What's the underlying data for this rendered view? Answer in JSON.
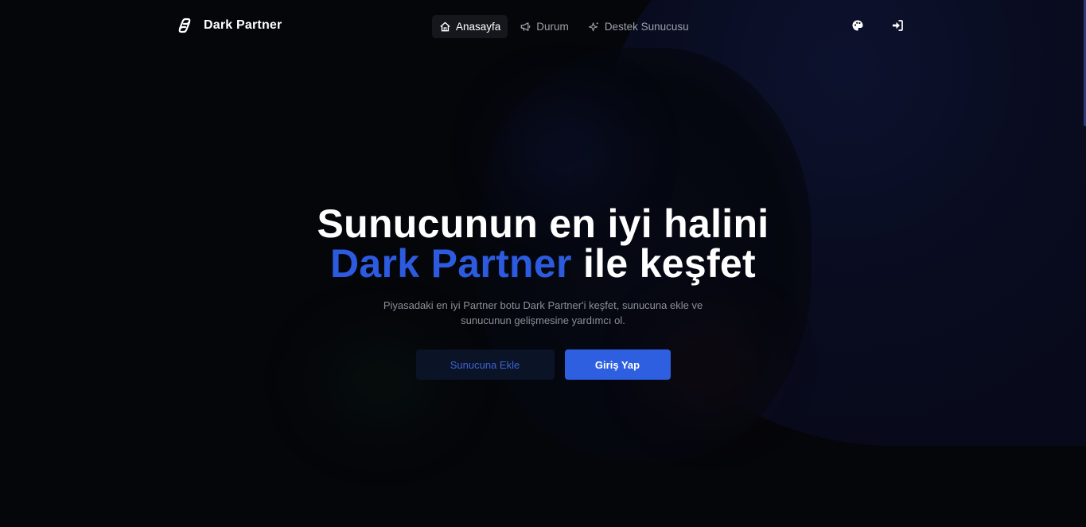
{
  "brand": {
    "name": "Dark Partner",
    "logo_icon": "link-logo-icon"
  },
  "nav": {
    "links": [
      {
        "label": "Anasayfa",
        "icon": "home-icon",
        "active": true
      },
      {
        "label": "Durum",
        "icon": "megaphone-icon",
        "active": false
      },
      {
        "label": "Destek Sunucusu",
        "icon": "sparkles-icon",
        "active": false
      }
    ],
    "actions": [
      {
        "icon": "palette-icon"
      },
      {
        "icon": "sign-in-icon"
      }
    ]
  },
  "hero": {
    "headline_line1": "Sunucunun en iyi halini",
    "headline_accent": "Dark Partner",
    "headline_line2_rest": " ile keşfet",
    "subtitle": "Piyasadaki en iyi Partner botu Dark Partner'i keşfet, sunucuna ekle ve sunucunun gelişmesine yardımcı ol.",
    "secondary_button": "Sunucuna Ekle",
    "primary_button": "Giriş Yap"
  },
  "colors": {
    "background": "#05060a",
    "accent": "#2d5be0",
    "primary_button": "#2d5fe0",
    "secondary_button_bg": "#0b1326"
  }
}
